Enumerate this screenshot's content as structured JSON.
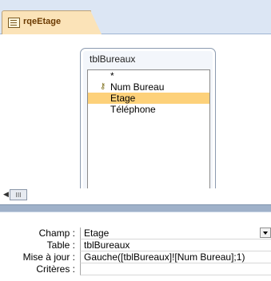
{
  "tab": {
    "label": "rqeEtage",
    "icon": "query-icon"
  },
  "table_box": {
    "title": "tblBureaux",
    "fields": [
      {
        "label": "*",
        "is_key": false,
        "selected": false
      },
      {
        "label": "Num Bureau",
        "is_key": true,
        "selected": false
      },
      {
        "label": "Etage",
        "is_key": false,
        "selected": true
      },
      {
        "label": "Téléphone",
        "is_key": false,
        "selected": false
      }
    ]
  },
  "scrollbar": {
    "thumb_label": "III"
  },
  "grid": {
    "rows": [
      {
        "label": "Champ :",
        "value": "Etage"
      },
      {
        "label": "Table :",
        "value": "tblBureaux"
      },
      {
        "label": "Mise à jour :",
        "value": "Gauche([tblBureaux]![Num Bureau];1)"
      },
      {
        "label": "Critères :",
        "value": ""
      }
    ]
  },
  "colors": {
    "tab_bg": "#fbe3b8",
    "selected_field": "#fdd17a",
    "tab_text": "#6b3a00"
  }
}
